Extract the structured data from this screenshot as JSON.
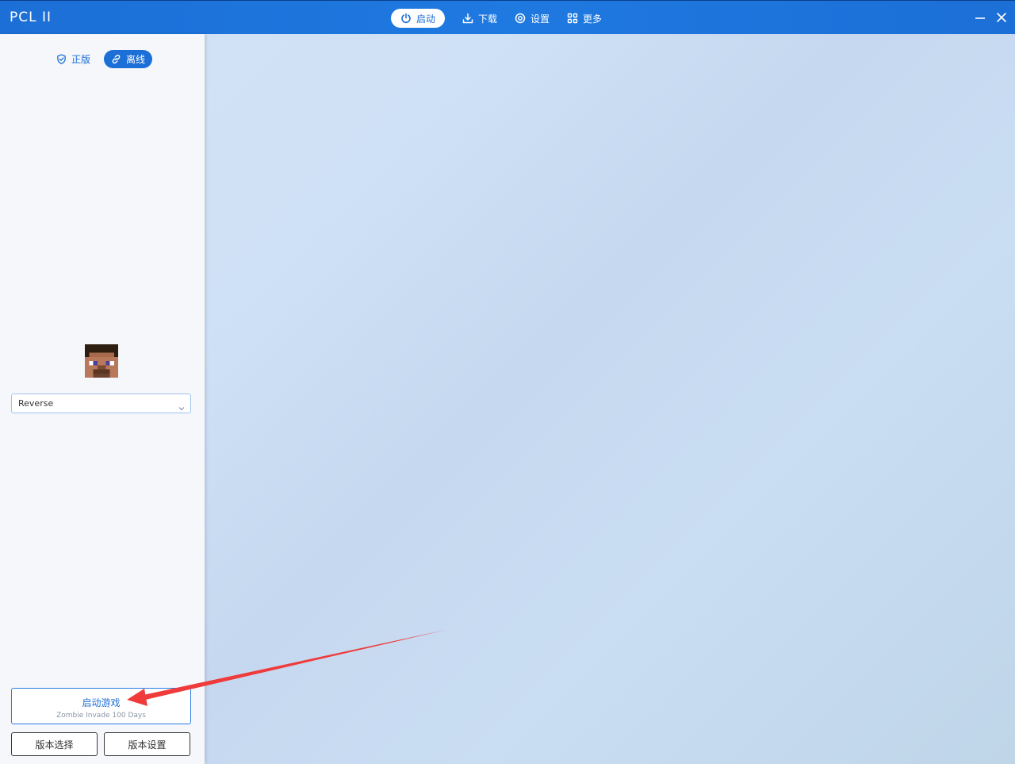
{
  "app": {
    "title": "PCL II"
  },
  "nav": {
    "items": [
      {
        "label": "启动",
        "icon": "power-icon",
        "active": true
      },
      {
        "label": "下载",
        "icon": "download-icon"
      },
      {
        "label": "设置",
        "icon": "gear-icon"
      },
      {
        "label": "更多",
        "icon": "grid-icon"
      }
    ]
  },
  "window_controls": {
    "minimize_icon": "minimize-icon",
    "close_icon": "close-icon"
  },
  "sidebar": {
    "modes": [
      {
        "label": "正版",
        "icon": "shield-check-icon",
        "active": false
      },
      {
        "label": "离线",
        "icon": "link-icon",
        "active": true
      }
    ],
    "user": {
      "name": "Reverse",
      "avatar": "minecraft-steve-avatar"
    },
    "launch": {
      "label": "启动游戏",
      "version": "Zombie Invade 100 Days"
    },
    "version_select_label": "版本选择",
    "version_settings_label": "版本设置"
  },
  "colors": {
    "accent": "#1c6fd6",
    "annotation": "#ef3b3b"
  }
}
